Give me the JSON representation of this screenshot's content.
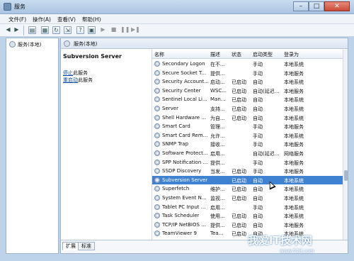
{
  "window": {
    "title": "服务"
  },
  "menu": [
    "文件(F)",
    "操作(A)",
    "查看(V)",
    "帮助(H)"
  ],
  "tree": {
    "root_label": "服务(本地)"
  },
  "header": {
    "label": "服务(本地)"
  },
  "details": {
    "service_name": "Subversion Server",
    "stop_link": "停止",
    "stop_suffix": "此服务",
    "restart_link": "重启动",
    "restart_suffix": "此服务"
  },
  "columns": [
    "名称",
    "描述",
    "状态",
    "启动类型",
    "登录为"
  ],
  "services": [
    {
      "name": "Secondary Logon",
      "desc": "在不...",
      "status": "",
      "startup": "手动",
      "logon": "本地系统"
    },
    {
      "name": "Secure Socket T...",
      "desc": "提供...",
      "status": "",
      "startup": "手动",
      "logon": "本地服务"
    },
    {
      "name": "Security Account...",
      "desc": "启动...",
      "status": "已启动",
      "startup": "自动",
      "logon": "本地系统"
    },
    {
      "name": "Security Center",
      "desc": "WSC...",
      "status": "已启动",
      "startup": "自动(延迟...",
      "logon": "本地服务"
    },
    {
      "name": "Sentinel Local Li...",
      "desc": "Man...",
      "status": "已启动",
      "startup": "自动",
      "logon": "本地系统"
    },
    {
      "name": "Server",
      "desc": "支持...",
      "status": "已启动",
      "startup": "自动",
      "logon": "本地系统"
    },
    {
      "name": "Shell Hardware ...",
      "desc": "为自...",
      "status": "已启动",
      "startup": "自动",
      "logon": "本地系统"
    },
    {
      "name": "Smart Card",
      "desc": "管理...",
      "status": "",
      "startup": "手动",
      "logon": "本地服务"
    },
    {
      "name": "Smart Card Rem...",
      "desc": "允许...",
      "status": "",
      "startup": "手动",
      "logon": "本地系统"
    },
    {
      "name": "SNMP Trap",
      "desc": "接收...",
      "status": "",
      "startup": "手动",
      "logon": "本地服务"
    },
    {
      "name": "Software Protect...",
      "desc": "启用...",
      "status": "",
      "startup": "自动(延迟...",
      "logon": "网络服务"
    },
    {
      "name": "SPP Notification ...",
      "desc": "提供...",
      "status": "",
      "startup": "手动",
      "logon": "本地服务"
    },
    {
      "name": "SSDP Discovery",
      "desc": "当发...",
      "status": "已启动",
      "startup": "手动",
      "logon": "本地服务"
    },
    {
      "name": "Subversion Server",
      "desc": "",
      "status": "已启动",
      "startup": "自动",
      "logon": "本地系统",
      "selected": true
    },
    {
      "name": "Superfetch",
      "desc": "维护...",
      "status": "已启动",
      "startup": "自动",
      "logon": "本地系统"
    },
    {
      "name": "System Event N...",
      "desc": "监视...",
      "status": "已启动",
      "startup": "自动",
      "logon": "本地系统"
    },
    {
      "name": "Tablet PC Input ...",
      "desc": "启用...",
      "status": "",
      "startup": "手动",
      "logon": "本地系统"
    },
    {
      "name": "Task Scheduler",
      "desc": "使用...",
      "status": "已启动",
      "startup": "自动",
      "logon": "本地系统"
    },
    {
      "name": "TCP/IP NetBIOS ...",
      "desc": "提供...",
      "status": "已启动",
      "startup": "自动",
      "logon": "本地服务"
    },
    {
      "name": "TeamViewer 9",
      "desc": "Tea...",
      "status": "已启动",
      "startup": "自动",
      "logon": "本地系统"
    }
  ],
  "tabs": [
    "扩展",
    "标准"
  ],
  "watermark": {
    "text": "我爱IT技术网",
    "url": "www.52ij.com"
  },
  "colors": {
    "selection": "#3f82d2",
    "link": "#0a4aa6"
  }
}
